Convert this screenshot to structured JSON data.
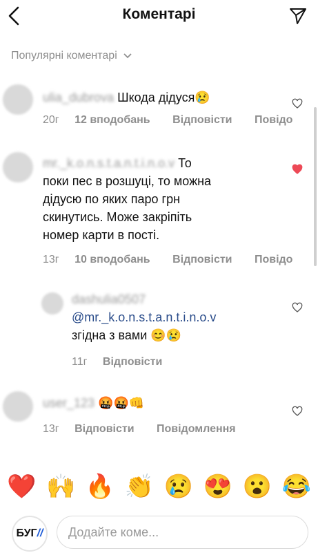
{
  "header": {
    "title": "Коментарі"
  },
  "filter": {
    "label": "Популярні коментарі"
  },
  "comments": [
    {
      "username": "ulia_dubrova",
      "text": "Шкода дідуся😢",
      "time": "20г",
      "likes": "12 вподобань",
      "reply": "Відповісти",
      "message": "Повідо",
      "liked": false
    },
    {
      "username": "mr._k.o.n.s.t.a.n.t.i.n.o.v",
      "text_lines": [
        "То",
        "поки пес в розшуці, то можна",
        "дідусю по яких паро грн",
        "скинутись. Може закріпіть",
        "номер карти в пості."
      ],
      "time": "13г",
      "likes": "10 вподобань",
      "reply": "Відповісти",
      "message": "Повідо",
      "liked": true
    },
    {
      "username": "dashulia0507",
      "mention": "@mr._k.o.n.s.t.a.n.t.i.n.o.v",
      "text": "згідна з вами 😊😢",
      "time": "11г",
      "reply": "Відповісти",
      "liked": false
    },
    {
      "username": "user_123",
      "text": "🤬🤬👊",
      "time": "13г",
      "reply": "Відповісти",
      "message": "Повідомлення",
      "liked": false
    }
  ],
  "emojis": [
    "❤️",
    "🙌",
    "🔥",
    "👏",
    "😢",
    "😍",
    "😮",
    "😂"
  ],
  "composer": {
    "logo_text": "БУГ",
    "logo_slashes": "//",
    "placeholder": "Додайте коме..."
  }
}
